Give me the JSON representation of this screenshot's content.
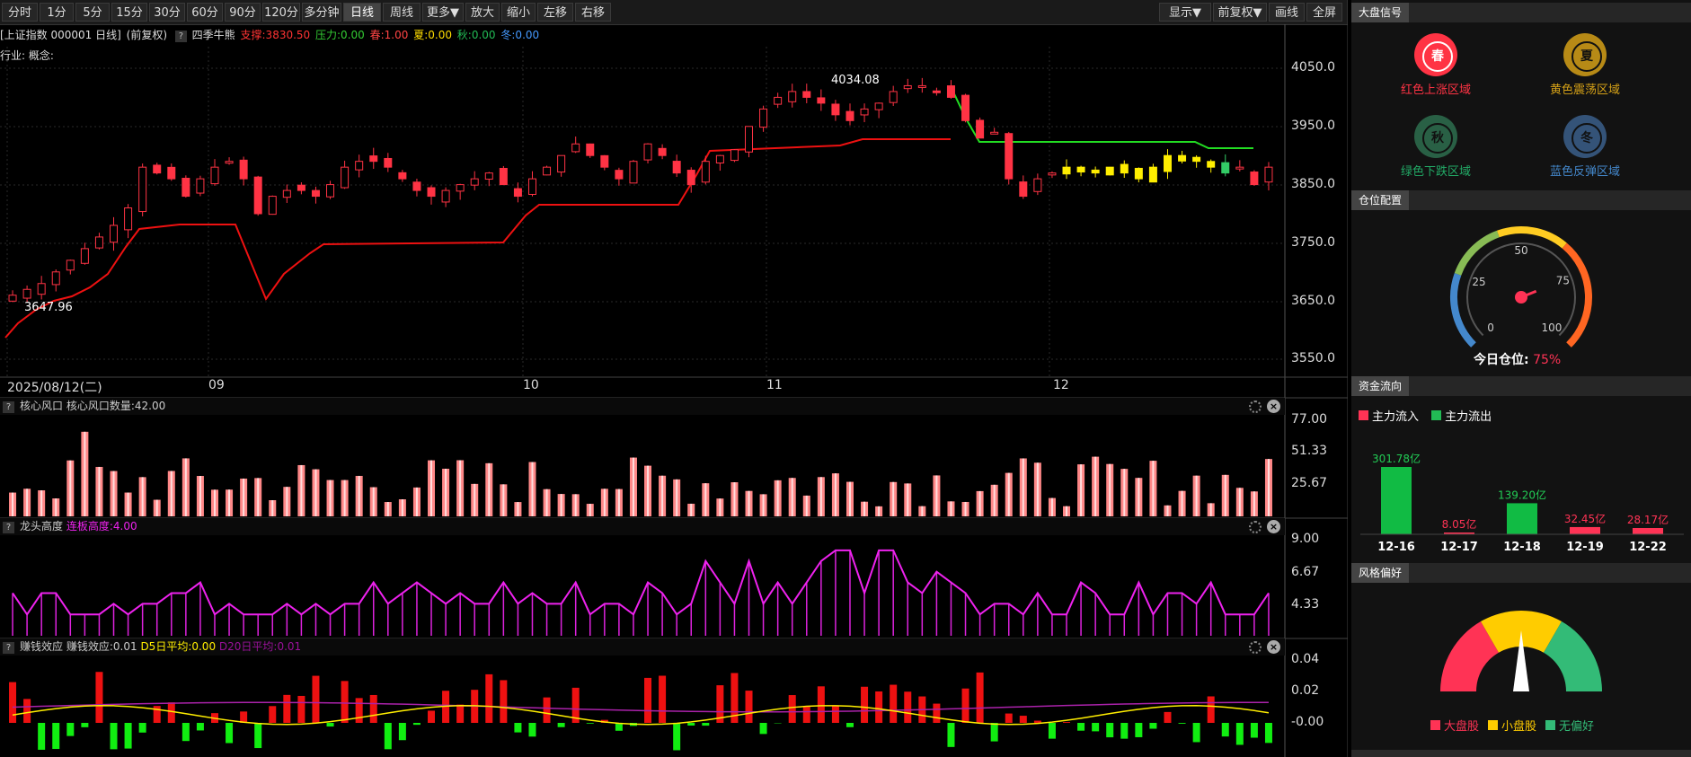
{
  "toolbar": {
    "periods": [
      "分时",
      "1分",
      "5分",
      "15分",
      "30分",
      "60分",
      "90分",
      "120分",
      "多分钟",
      "日线",
      "周线",
      "更多▼",
      "放大",
      "缩小",
      "左移",
      "右移"
    ],
    "right_buttons": [
      "显示▼",
      "前复权▼",
      "画线",
      "全屏"
    ]
  },
  "info": {
    "title": "[上证指数 000001 日线]",
    "adj": "(前复权)",
    "q": "?",
    "indicator": "四季牛熊",
    "support": "支撑:3830.50",
    "pressure": "压力:0.00",
    "spring": "春:1.00",
    "summer": "夏:0.00",
    "autumn": "秋:0.00",
    "winter": "冬:0.00"
  },
  "industry": "行业: 概念:",
  "main_chart": {
    "y_ticks": [
      "4050.0",
      "3950.0",
      "3850.0",
      "3750.0",
      "3650.0",
      "3550.0"
    ],
    "high_label": "4034.08",
    "low_label": "3647.96",
    "date_labels": [
      "2025/08/12(二)",
      "09",
      "10",
      "11",
      "12"
    ]
  },
  "panel1": {
    "name": "核心风口",
    "value": "核心风口数量:42.00",
    "y_ticks": [
      "77.00",
      "51.33",
      "25.67"
    ]
  },
  "panel2": {
    "name": "龙头高度",
    "value": "连板高度:4.00",
    "y_ticks": [
      "9.00",
      "6.67",
      "4.33"
    ]
  },
  "panel3": {
    "name": "赚钱效应",
    "value": "赚钱效应:0.01",
    "d5": "D5日平均:0.00",
    "d20": "D20日平均:0.01",
    "y_ticks": [
      "0.04",
      "0.02",
      "-0.00"
    ]
  },
  "right": {
    "signal_title": "大盘信号",
    "seasons": [
      {
        "char": "春",
        "label": "红色上涨区域",
        "color": "#ff3344"
      },
      {
        "char": "夏",
        "label": "黄色震荡区域",
        "color": "#d4a017"
      },
      {
        "char": "秋",
        "label": "绿色下跌区域",
        "color": "#2e6e4e"
      },
      {
        "char": "冬",
        "label": "蓝色反弹区域",
        "color": "#3a5f8a"
      }
    ],
    "position_title": "仓位配置",
    "gauge_ticks": [
      "0",
      "25",
      "50",
      "75",
      "100"
    ],
    "today_label": "今日仓位:",
    "today_value": "75%",
    "flow_title": "资金流向",
    "flow_in": "主力流入",
    "flow_out": "主力流出",
    "flow_bars": [
      {
        "date": "12-16",
        "label": "301.78亿",
        "value": 301.78,
        "dir": "out"
      },
      {
        "date": "12-17",
        "label": "8.05亿",
        "value": 8.05,
        "dir": "in"
      },
      {
        "date": "12-18",
        "label": "139.20亿",
        "value": 139.2,
        "dir": "out"
      },
      {
        "date": "12-19",
        "label": "32.45亿",
        "value": 32.45,
        "dir": "in"
      },
      {
        "date": "12-22",
        "label": "28.17亿",
        "value": 28.17,
        "dir": "in"
      }
    ],
    "style_title": "风格偏好",
    "style_legend": [
      "大盘股",
      "小盘股",
      "无偏好"
    ]
  }
}
